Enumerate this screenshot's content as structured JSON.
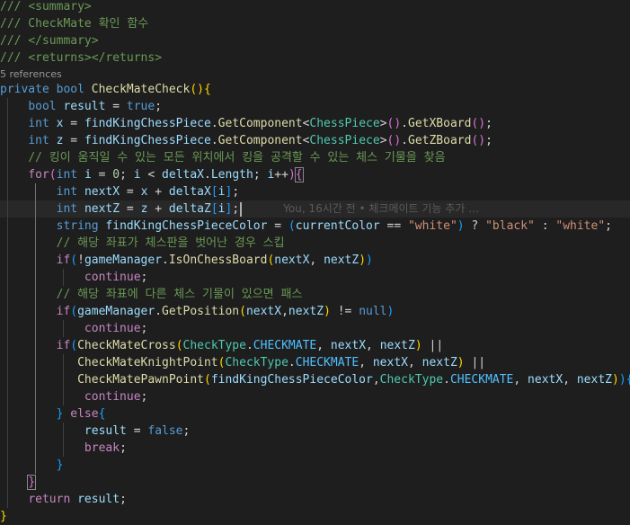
{
  "code": {
    "l1": [
      "/// ",
      "<summary>"
    ],
    "l2": "/// CheckMate 확인 함수",
    "l3": [
      "/// ",
      "</summary>"
    ],
    "l4": [
      "/// ",
      "<returns></returns>"
    ],
    "codelens": "5 references",
    "l5": [
      "private",
      " ",
      "bool",
      " ",
      "CheckMateCheck",
      "(",
      ")",
      "{"
    ],
    "l6": [
      "bool",
      " ",
      "result",
      " = ",
      "true",
      ";"
    ],
    "l7": [
      "int",
      " ",
      "x",
      " = ",
      "findKingChessPiece",
      ".",
      "GetComponent",
      "<",
      "ChessPiece",
      ">",
      "(",
      ")",
      ".",
      "GetXBoard",
      "(",
      ")",
      ";"
    ],
    "l8": [
      "int",
      " ",
      "z",
      " = ",
      "findKingChessPiece",
      ".",
      "GetComponent",
      "<",
      "ChessPiece",
      ">",
      "(",
      ")",
      ".",
      "GetZBoard",
      "(",
      ")",
      ";"
    ],
    "l9": "// 킹이 움직일 수 있는 모든 위치에서 킹을 공격할 수 있는 체스 기물을 찾음",
    "l10": [
      "for",
      "(",
      "int",
      " ",
      "i",
      " = ",
      "0",
      "; ",
      "i",
      " < ",
      "deltaX",
      ".",
      "Length",
      "; ",
      "i",
      "++",
      ")",
      "{"
    ],
    "l11": [
      "int",
      " ",
      "nextX",
      " = ",
      "x",
      " + ",
      "deltaX",
      "[",
      "i",
      "]",
      ";"
    ],
    "l12": [
      "int",
      " ",
      "nextZ",
      " = ",
      "z",
      " + ",
      "deltaZ",
      "[",
      "i",
      "]",
      ";"
    ],
    "blame": "You, 16시간 전 • 체크메이트 기능 추가 …",
    "l13": [
      "string",
      " ",
      "findKingChessPieceColor",
      " = ",
      "(",
      "currentColor",
      " == ",
      "\"white\"",
      ")",
      " ? ",
      "\"black\"",
      " : ",
      "\"white\"",
      ";"
    ],
    "l14": "// 해당 좌표가 체스판을 벗어난 경우 스킵",
    "l15": [
      "if",
      "(",
      "!",
      "gameManager",
      ".",
      "IsOnChessBoard",
      "(",
      "nextX",
      ", ",
      "nextZ",
      ")",
      ")"
    ],
    "l16": [
      "continue",
      ";"
    ],
    "l17": "// 해당 좌표에 다른 체스 기물이 있으면 패스",
    "l18": [
      "if",
      "(",
      "gameManager",
      ".",
      "GetPosition",
      "(",
      "nextX",
      ",",
      "nextZ",
      ")",
      " != ",
      "null",
      ")"
    ],
    "l19": [
      "continue",
      ";"
    ],
    "l20": [
      "if",
      "(",
      "CheckMateCross",
      "(",
      "CheckType",
      ".",
      "CHECKMATE",
      ", ",
      "nextX",
      ", ",
      "nextZ",
      ")",
      " ||"
    ],
    "l21": [
      "CheckMateKnightPoint",
      "(",
      "CheckType",
      ".",
      "CHECKMATE",
      ", ",
      "nextX",
      ", ",
      "nextZ",
      ")",
      " ||"
    ],
    "l22": [
      "CheckMatePawnPoint",
      "(",
      "findKingChessPieceColor",
      ",",
      "CheckType",
      ".",
      "CHECKMATE",
      ", ",
      "nextX",
      ", ",
      "nextZ",
      ")",
      ")",
      "{"
    ],
    "l23": [
      "continue",
      ";"
    ],
    "l24": [
      "}",
      " ",
      "else",
      "{"
    ],
    "l25": [
      "result",
      " = ",
      "false",
      ";"
    ],
    "l26": [
      "break",
      ";"
    ],
    "l27": "}",
    "l28": "}",
    "l29": [
      "return",
      " ",
      "result",
      ";"
    ],
    "l30": "}"
  }
}
